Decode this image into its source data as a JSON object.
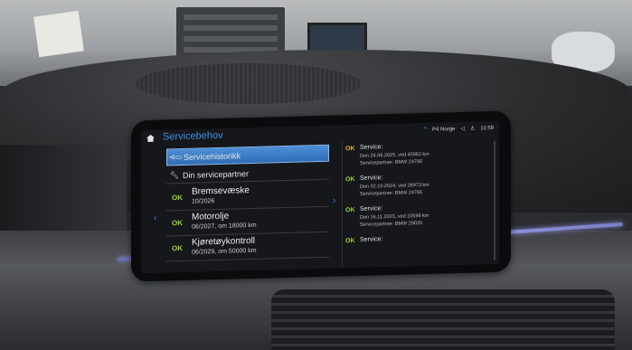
{
  "screen": {
    "title": "Servicebehov",
    "status": {
      "station": "P4 Norge",
      "clock": "11:59"
    }
  },
  "menu": {
    "history_label": "Servicehistorikk",
    "partner_label": "Din servicepartner"
  },
  "service_items": [
    {
      "status": "OK",
      "name": "Bremsevæske",
      "due": "10/2026"
    },
    {
      "status": "OK",
      "name": "Motorolje",
      "due": "06/2027, om 18000 km"
    },
    {
      "status": "OK",
      "name": "Kjøretøykontroll",
      "due": "06/2029, om 50000 km"
    }
  ],
  "history": [
    {
      "status": "OK",
      "label": "Service:",
      "date_line": "Den 24.06.2025, ved 45962 km",
      "partner_line": "Servicepartner: BMW 24766"
    },
    {
      "status": "OK",
      "label": "Service:",
      "date_line": "Den 02.10.2024, ved 28973 km",
      "partner_line": "Servicepartner: BMW 24766"
    },
    {
      "status": "OK",
      "label": "Service:",
      "date_line": "Den 16.11.2023, ved 10599 km",
      "partner_line": "Servicepartner: BMW 29020"
    },
    {
      "status": "OK",
      "label": "Service:"
    }
  ],
  "colors": {
    "accent": "#3b8fe6",
    "ok_green": "#9bd33a",
    "ok_amber": "#e4b43a",
    "selected": "#2f6db5"
  },
  "icons": [
    "home-icon",
    "car-history-icon",
    "wrench-icon",
    "chevron-left-icon",
    "chevron-right-icon",
    "chevron-up-icon"
  ]
}
